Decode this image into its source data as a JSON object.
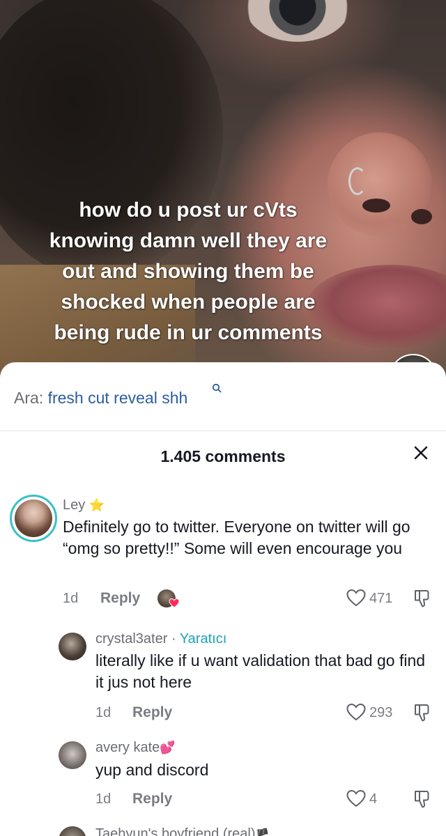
{
  "video": {
    "overlay_lines": [
      "how do u post ur cVts",
      "knowing damn well they are",
      "out and showing them be",
      "shocked when people are",
      "being rude in ur comments"
    ]
  },
  "search": {
    "prefix": "Ara:",
    "term": "fresh cut reveal shh",
    "icon": "search-icon",
    "accent_color": "#2b5d9f"
  },
  "comments_header": {
    "title": "1.405 comments",
    "close_icon": "close-icon"
  },
  "comments": [
    {
      "username": "Ley",
      "badge": "⭐",
      "text": "Definitely go to twitter. Everyone on twitter will go “omg so pretty!!” Some will even encourage you",
      "age": "1d",
      "reply_label": "Reply",
      "likes": "471"
    },
    {
      "username": "crystal3ater",
      "separator": "·",
      "creator_label": "Yaratıcı",
      "text": "literally like if u want validation that bad go find it jus not here",
      "age": "1d",
      "reply_label": "Reply",
      "likes": "293"
    },
    {
      "username": "avery kate",
      "badge": "💕",
      "text": "yup and discord",
      "age": "1d",
      "reply_label": "Reply",
      "likes": "4"
    },
    {
      "username": "Taehyun's boyfriend (real)",
      "badge": "🏴"
    }
  ],
  "colors": {
    "creator_tag": "#1ca3b8",
    "avatar_ring": "#37c1c9",
    "liked_heart": "#fe2c55"
  }
}
